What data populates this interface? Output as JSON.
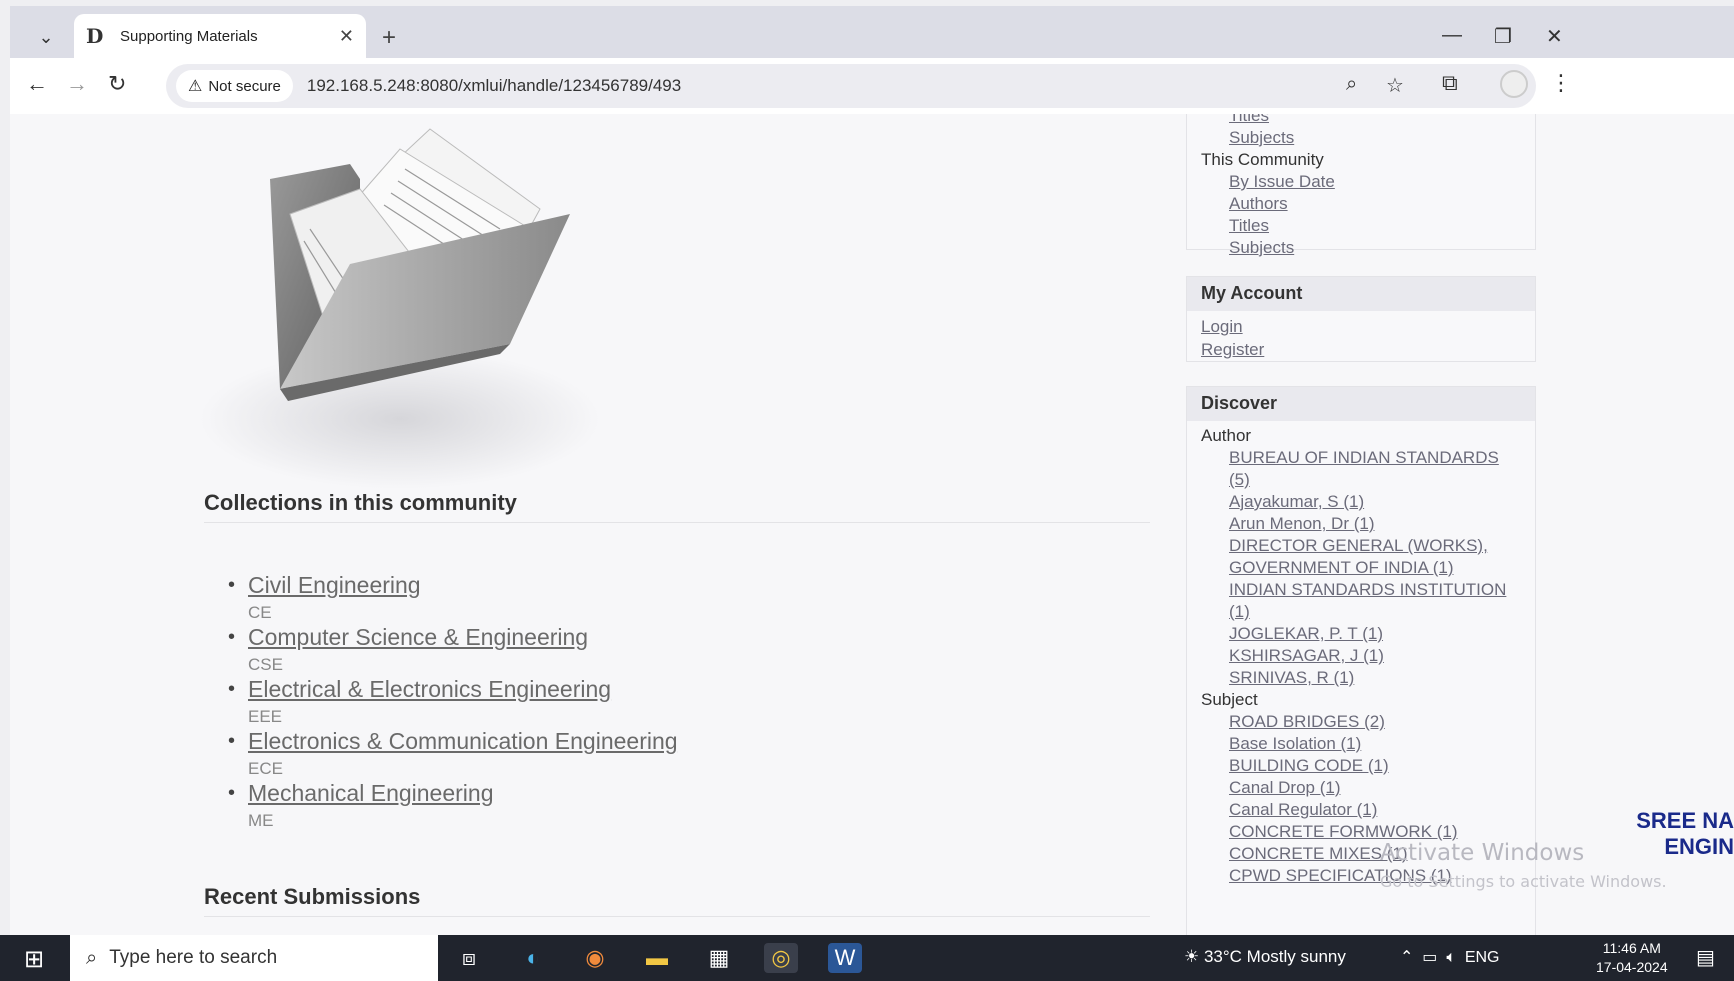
{
  "browser": {
    "tab_title": "Supporting Materials",
    "favicon_letter": "D",
    "tab_list_icon": "chevron-down-icon",
    "close_glyph": "✕",
    "new_tab_glyph": "+",
    "security_label": "Not secure",
    "url": "192.168.5.248:8080/xmlui/handle/123456789/493"
  },
  "main": {
    "collections_heading": "Collections in this community",
    "collections": [
      {
        "name": "Civil Engineering",
        "abbr": "CE"
      },
      {
        "name": "Computer Science & Engineering",
        "abbr": "CSE"
      },
      {
        "name": "Electrical & Electronics Engineering",
        "abbr": "EEE"
      },
      {
        "name": "Electronics & Communication Engineering",
        "abbr": "ECE"
      },
      {
        "name": "Mechanical Engineering",
        "abbr": "ME"
      }
    ],
    "recent_heading": "Recent Submissions"
  },
  "sidebar": {
    "browse_top": [
      "Titles",
      "Subjects"
    ],
    "this_community_label": "This Community",
    "this_community": [
      "By Issue Date",
      "Authors",
      "Titles",
      "Subjects"
    ],
    "account_heading": "My Account",
    "account_links": [
      "Login",
      "Register"
    ],
    "discover_heading": "Discover",
    "author_label": "Author",
    "authors": [
      "BUREAU OF INDIAN STANDARDS",
      "(5)",
      "Ajayakumar, S (1)",
      "Arun Menon, Dr (1)",
      "DIRECTOR GENERAL (WORKS),",
      "GOVERNMENT OF INDIA (1)",
      "INDIAN STANDARDS INSTITUTION",
      "(1)",
      "JOGLEKAR, P. T (1)",
      "KSHIRSAGAR, J (1)",
      "SRINIVAS, R (1)"
    ],
    "subject_label": "Subject",
    "subjects": [
      "ROAD BRIDGES (2)",
      "Base Isolation (1)",
      "BUILDING CODE (1)",
      "Canal Drop (1)",
      "Canal Regulator (1)",
      "CONCRETE FORMWORK (1)",
      "CONCRETE MIXES (1)",
      "CPWD SPECIFICATIONS (1)"
    ]
  },
  "overlay": {
    "watermark_title": "Activate Windows",
    "watermark_sub": "Go to Settings to activate Windows.",
    "edge_text": [
      "SREE NA",
      "ENGIN"
    ]
  },
  "taskbar": {
    "search_placeholder": "Type here to search",
    "weather": "33°C  Mostly sunny",
    "language": "ENG",
    "time": "11:46 AM",
    "date": "17-04-2024"
  },
  "colors": {
    "page_bg": "#f7f7f9",
    "link": "#6b6b7a",
    "taskbar": "#20242d"
  }
}
